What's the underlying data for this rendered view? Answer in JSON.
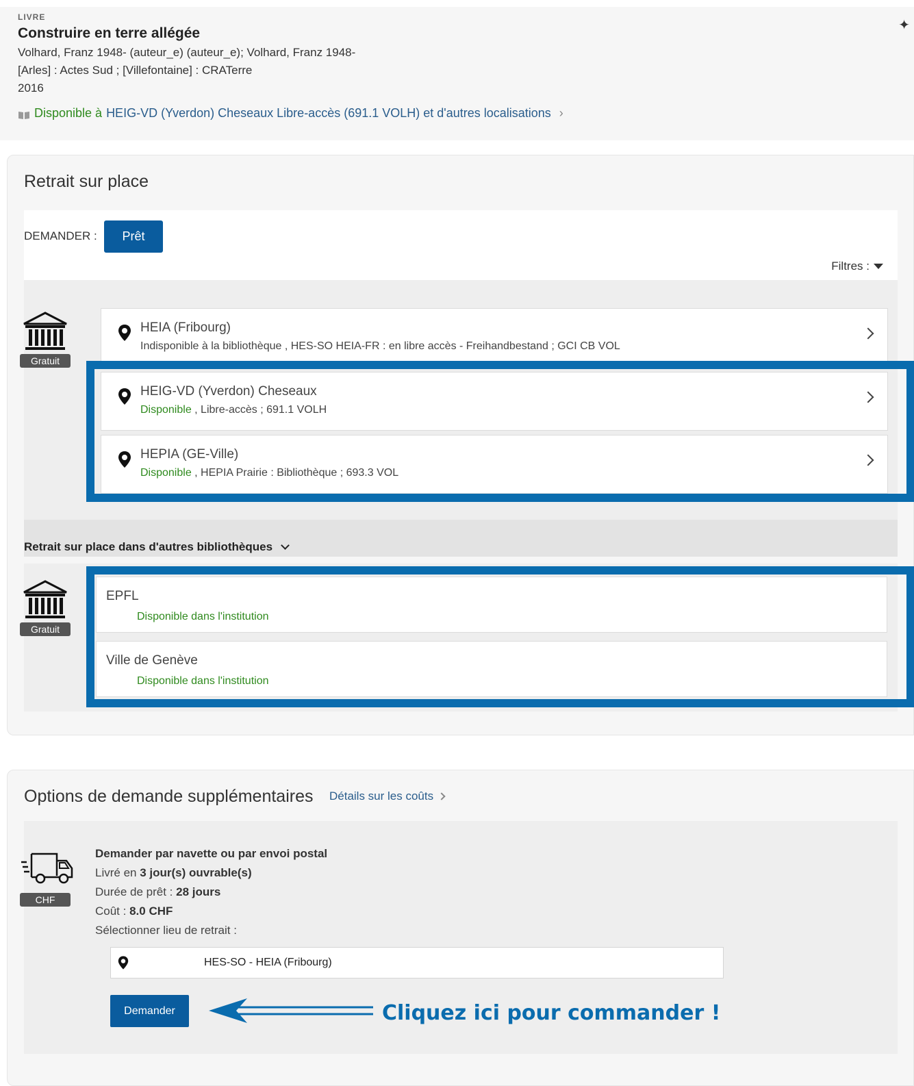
{
  "record": {
    "type": "LIVRE",
    "title": "Construire en terre allégée",
    "authors": "Volhard, Franz 1948- (auteur_e) (auteur_e); Volhard, Franz 1948-",
    "publisher": "[Arles] : Actes Sud ; [Villefontaine] : CRATerre",
    "year": "2016",
    "availability_status": "Disponible à",
    "availability_location": "HEIG-VD (Yverdon) Cheseaux  Libre-accès (691.1 VOLH) et d'autres localisations"
  },
  "pickup": {
    "title": "Retrait sur place",
    "request_label": "DEMANDER :",
    "loan_button": "Prêt",
    "filters_label": "Filtres :",
    "badge": "Gratuit",
    "locations": [
      {
        "name": "HEIA (Fribourg)",
        "status": "",
        "detail": "Indisponible à la bibliothèque , HES-SO HEIA-FR : en libre accès - Freihandbestand ; GCI CB VOL"
      },
      {
        "name": "HEIG-VD (Yverdon) Cheseaux",
        "status": "Disponible",
        "detail": " , Libre-accès ; 691.1 VOLH"
      },
      {
        "name": "HEPIA (GE-Ville)",
        "status": "Disponible",
        "detail": " , HEPIA Prairie : Bibliothèque ; 693.3 VOL"
      }
    ],
    "other_libraries_label": "Retrait sur place dans d'autres bibliothèques",
    "institutions": [
      {
        "name": "EPFL",
        "status": "Disponible dans l'institution"
      },
      {
        "name": "Ville de Genève",
        "status": "Disponible dans l'institution"
      }
    ]
  },
  "more_options": {
    "title": "Options de demande supplémentaires",
    "cost_link": "Détails sur les coûts",
    "badge": "CHF",
    "option_title": "Demander par navette ou par envoi postal",
    "delivered_prefix": "Livré en ",
    "delivered_value": "3 jour(s) ouvrable(s)",
    "loan_prefix": "Durée de prêt : ",
    "loan_value": "28 jours",
    "cost_prefix": "Coût : ",
    "cost_value": "8.0  CHF",
    "select_label": "Sélectionner lieu de retrait :",
    "pickup_location": "HES-SO - HEIA (Fribourg)",
    "request_button": "Demander"
  },
  "annotation": {
    "callout": "Cliquez ici pour commander !"
  },
  "colors": {
    "primary": "#0a5c9e",
    "highlight": "#0a6cae",
    "available": "#2f8a1e",
    "link": "#2a5d8c"
  }
}
